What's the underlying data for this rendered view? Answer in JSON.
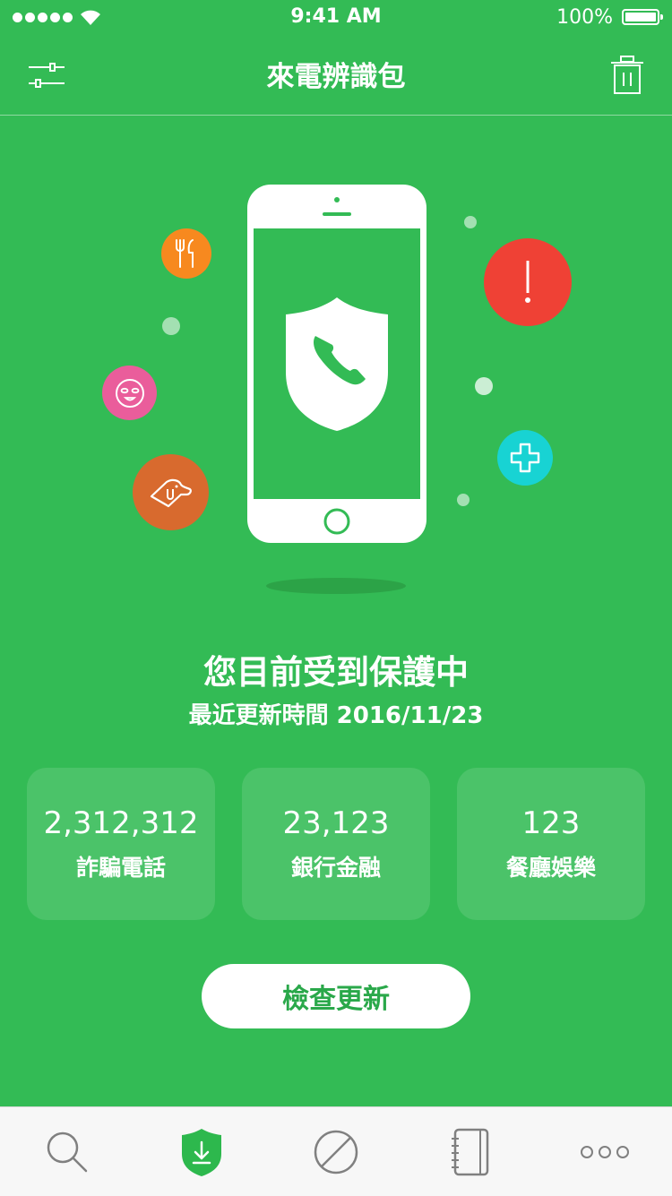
{
  "status_bar": {
    "time": "9:41 AM",
    "battery": "100%"
  },
  "nav": {
    "title": "來電辨識包"
  },
  "protection": {
    "title": "您目前受到保護中",
    "subtitle": "最近更新時間 2016/11/23"
  },
  "stats": [
    {
      "value": "2,312,312",
      "label": "詐騙電話"
    },
    {
      "value": "23,123",
      "label": "銀行金融"
    },
    {
      "value": "123",
      "label": "餐廳娛樂"
    }
  ],
  "update_button": {
    "label": "檢查更新"
  },
  "category_icons": [
    "utensils-icon",
    "face-mask-icon",
    "pet-icon",
    "alert-icon",
    "medical-cross-icon"
  ],
  "tabs": [
    "search-icon",
    "shield-download-icon",
    "block-icon",
    "notebook-icon",
    "more-icon"
  ],
  "colors": {
    "background": "#33bb55",
    "restaurant": "#f7891f",
    "beauty": "#ea5d9b",
    "pet": "#d86a2e",
    "alert": "#ef4135",
    "medical": "#18d3d3",
    "active_tab": "#2db84d",
    "inactive_tab": "#808080"
  }
}
